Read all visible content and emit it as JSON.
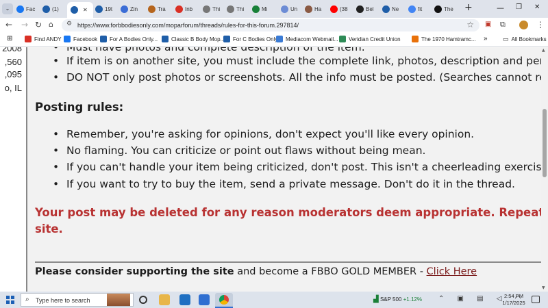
{
  "browser": {
    "tabs": [
      {
        "label": "Fac",
        "color": "#1877f2"
      },
      {
        "label": "(1)",
        "color": "#1f5ea8"
      },
      {
        "label": "",
        "color": "#1f5ea8",
        "active": true
      },
      {
        "label": "19t",
        "color": "#1f5ea8"
      },
      {
        "label": "Zin",
        "color": "#3b6dd6"
      },
      {
        "label": "Tra",
        "color": "#b5651d"
      },
      {
        "label": "Inb",
        "color": "#d93025"
      },
      {
        "label": "Thi",
        "color": "#777777"
      },
      {
        "label": "Thi",
        "color": "#777777"
      },
      {
        "label": "Mi",
        "color": "#188038"
      },
      {
        "label": "Un",
        "color": "#6c8cd5"
      },
      {
        "label": "Ha",
        "color": "#8a5a44"
      },
      {
        "label": "(38",
        "color": "#ff0000"
      },
      {
        "label": "Bel",
        "color": "#222222"
      },
      {
        "label": "Ne",
        "color": "#1f5ea8"
      },
      {
        "label": "fit",
        "color": "#4285f4"
      },
      {
        "label": "The",
        "color": "#111111"
      }
    ],
    "new_tab_symbol": "+",
    "window_controls": {
      "minimize": "—",
      "restore": "❐",
      "close": "✕"
    },
    "url": "https://www.forbbodiesonly.com/moparforum/threads/rules-for-this-forum.297814/",
    "bookmarks": [
      {
        "label": "Find ANDY",
        "color": "#d93025"
      },
      {
        "label": "Facebook",
        "color": "#1877f2"
      },
      {
        "label": "For A Bodies Only...",
        "color": "#1f5ea8"
      },
      {
        "label": "Classic B Body Mop...",
        "color": "#1f5ea8"
      },
      {
        "label": "For C Bodies Only",
        "color": "#1f5ea8"
      },
      {
        "label": "Mediacom Webmail...",
        "color": "#3a7bd5"
      },
      {
        "label": "Veridian Credit Union",
        "color": "#2e8b57"
      },
      {
        "label": "The 1970 Hamtramc...",
        "color": "#e8710a"
      }
    ],
    "all_bookmarks_label": "All Bookmarks"
  },
  "page": {
    "left_column_values": [
      "2008",
      ",560",
      ",095",
      "o, IL"
    ],
    "top_bullets": [
      "Must have photos and complete description of the item.",
      "If item is on another site, you must include the complete link, photos, description and pertinent info.",
      "DO NOT only post photos or screenshots. All the info must be posted. (Searches cannot read screenshots.)"
    ],
    "posting_rules_heading": "Posting rules:",
    "posting_rules": [
      "Remember, you're asking for opinions, don't expect you'll like every opinion.",
      "No flaming. You can criticize or point out flaws without being mean.",
      "If you can't handle your item being criticized, don't post. This isn't a cheerleading exercise.",
      "If you want to try to buy the item, send a private message. Don't do it in the thread."
    ],
    "warning_line1": "Your post may be deleted for any reason moderators deem appropriate. Repeated problems may result in being banned from the",
    "warning_line2": "site.",
    "support_bold": "Please consider supporting the site",
    "support_text": " and become a FBBO GOLD MEMBER - ",
    "support_link": "Click Here",
    "bullet_symbol": "•"
  },
  "taskbar": {
    "search_placeholder": "Type here to search",
    "market_label": "S&P 500",
    "market_change": "+1.12%",
    "tray_icons": "⌃ ▣ ▤ ◁ ◠",
    "time": "2:54 PM",
    "date": "1/17/2025"
  }
}
